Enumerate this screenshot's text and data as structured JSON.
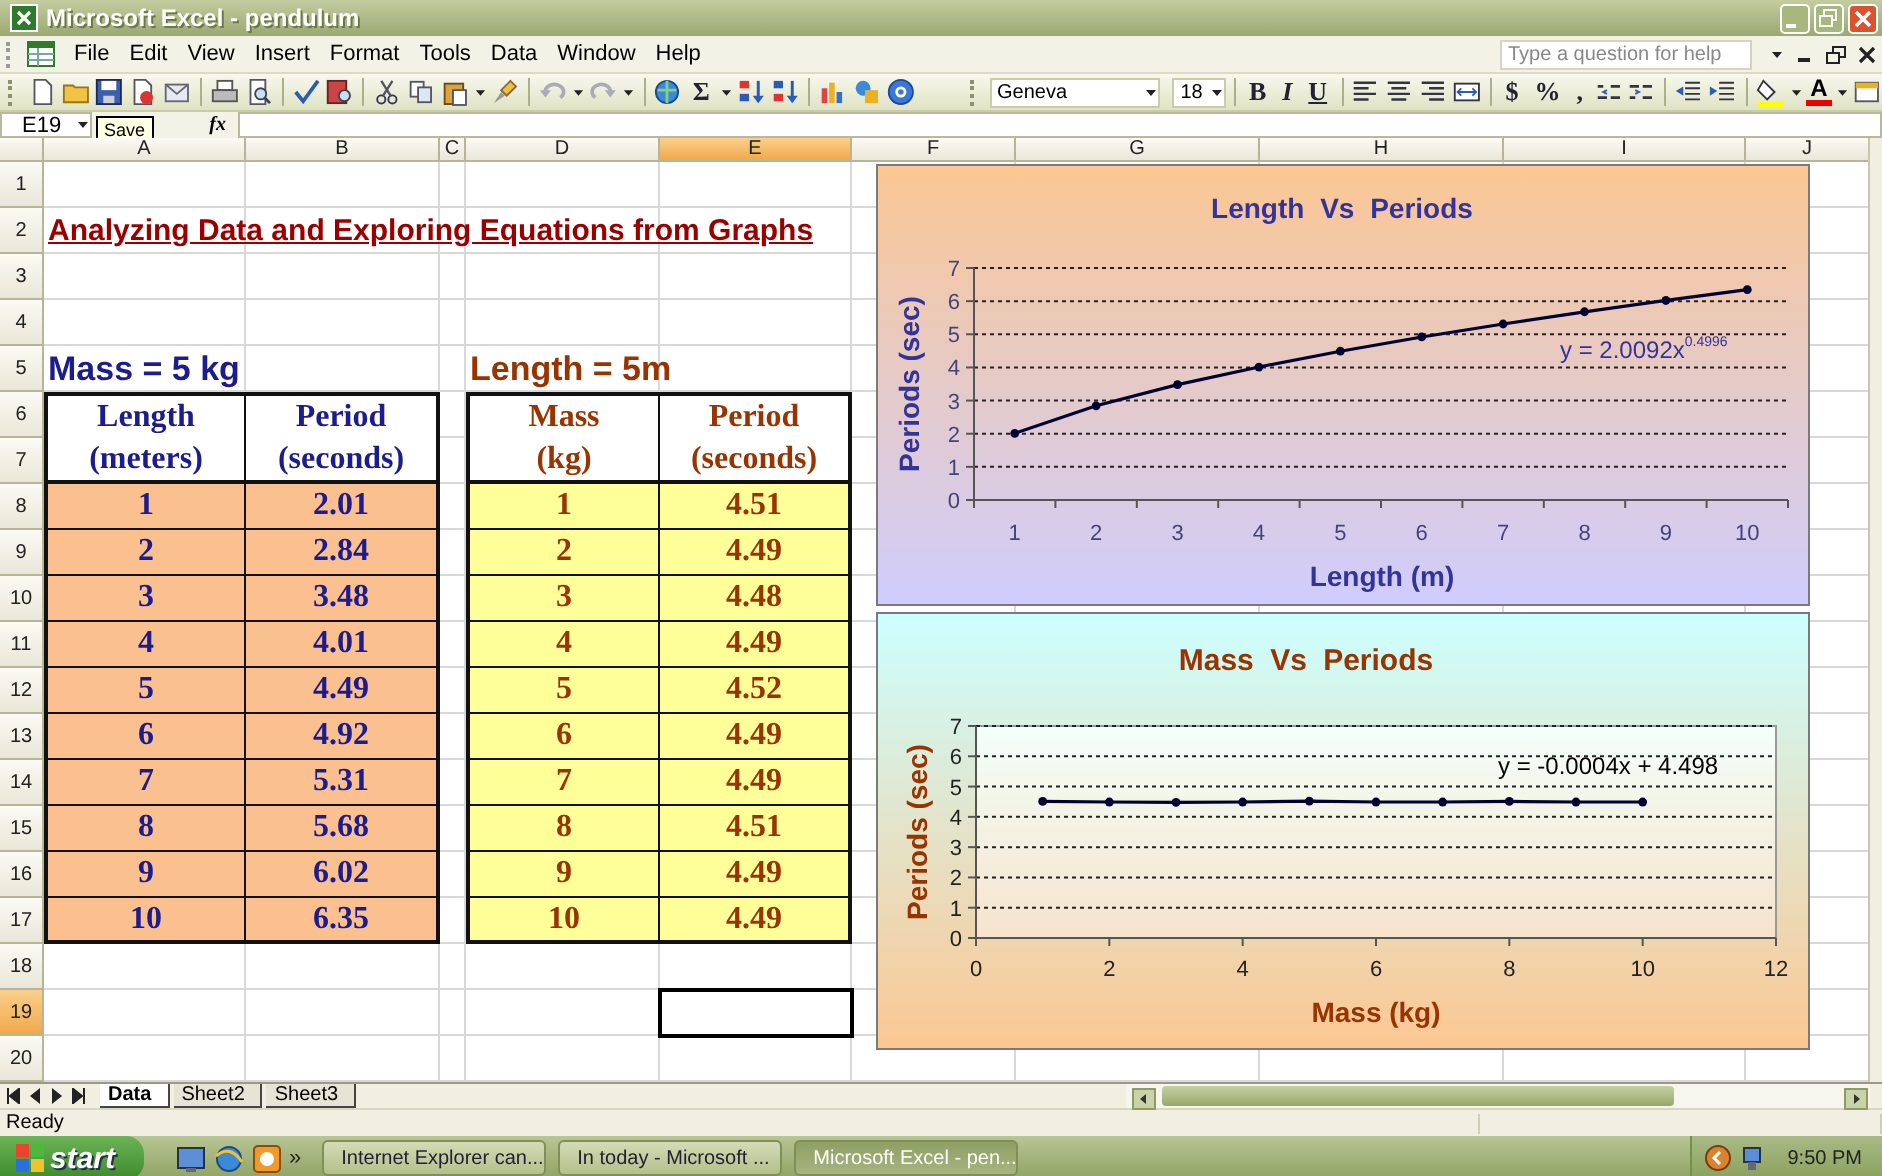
{
  "window": {
    "title": "Microsoft Excel - pendulum"
  },
  "menu": [
    "File",
    "Edit",
    "View",
    "Insert",
    "Format",
    "Tools",
    "Data",
    "Window",
    "Help"
  ],
  "help_search": {
    "placeholder": "Type a question for help"
  },
  "toolbar": {
    "autosum": "Σ",
    "font": "Geneva",
    "font_size": "18",
    "format_buttons": [
      "B",
      "I",
      "U"
    ],
    "number_buttons": [
      "$",
      "%",
      ","
    ],
    "font_color": "A"
  },
  "formula_bar": {
    "name_box": "E19",
    "tooltip": "Save",
    "function_label": "fx"
  },
  "sheet": {
    "columns": [
      {
        "label": "A",
        "selected": false
      },
      {
        "label": "B",
        "selected": false
      },
      {
        "label": "C",
        "selected": false
      },
      {
        "label": "D",
        "selected": false
      },
      {
        "label": "E",
        "selected": true
      },
      {
        "label": "F",
        "selected": false
      },
      {
        "label": "G",
        "selected": false
      },
      {
        "label": "H",
        "selected": false
      },
      {
        "label": "I",
        "selected": false
      },
      {
        "label": "J",
        "selected": false
      }
    ],
    "rows": [
      {
        "label": "1",
        "selected": false
      },
      {
        "label": "2",
        "selected": false
      },
      {
        "label": "3",
        "selected": false
      },
      {
        "label": "4",
        "selected": false
      },
      {
        "label": "5",
        "selected": false
      },
      {
        "label": "6",
        "selected": false
      },
      {
        "label": "7",
        "selected": false
      },
      {
        "label": "8",
        "selected": false
      },
      {
        "label": "9",
        "selected": false
      },
      {
        "label": "10",
        "selected": false
      },
      {
        "label": "11",
        "selected": false
      },
      {
        "label": "12",
        "selected": false
      },
      {
        "label": "13",
        "selected": false
      },
      {
        "label": "14",
        "selected": false
      },
      {
        "label": "15",
        "selected": false
      },
      {
        "label": "16",
        "selected": false
      },
      {
        "label": "17",
        "selected": false
      },
      {
        "label": "18",
        "selected": false
      },
      {
        "label": "19",
        "selected": true
      },
      {
        "label": "20",
        "selected": false
      }
    ],
    "title": "Analyzing Data and Exploring Equations from Graphs",
    "tables": [
      {
        "kind": "length",
        "caption": "Mass = 5 kg",
        "headers": [
          [
            "Length",
            "(meters)"
          ],
          [
            "Period",
            "(seconds)"
          ]
        ],
        "rows": [
          [
            "1",
            "2.01"
          ],
          [
            "2",
            "2.84"
          ],
          [
            "3",
            "3.48"
          ],
          [
            "4",
            "4.01"
          ],
          [
            "5",
            "4.49"
          ],
          [
            "6",
            "4.92"
          ],
          [
            "7",
            "5.31"
          ],
          [
            "8",
            "5.68"
          ],
          [
            "9",
            "6.02"
          ],
          [
            "10",
            "6.35"
          ]
        ]
      },
      {
        "kind": "mass",
        "caption": "Length = 5m",
        "headers": [
          [
            "Mass",
            "(kg)"
          ],
          [
            "Period",
            "(seconds)"
          ]
        ],
        "rows": [
          [
            "1",
            "4.51"
          ],
          [
            "2",
            "4.49"
          ],
          [
            "3",
            "4.48"
          ],
          [
            "4",
            "4.49"
          ],
          [
            "5",
            "4.52"
          ],
          [
            "6",
            "4.49"
          ],
          [
            "7",
            "4.49"
          ],
          [
            "8",
            "4.51"
          ],
          [
            "9",
            "4.49"
          ],
          [
            "10",
            "4.49"
          ]
        ]
      }
    ]
  },
  "charts": [
    {
      "kind": "peach",
      "chart_data": {
        "type": "line",
        "title": "Length Vs Periods",
        "xlabel": "Length (m)",
        "ylabel": "Periods (sec)",
        "categories": [
          "1",
          "2",
          "3",
          "4",
          "5",
          "6",
          "7",
          "8",
          "9",
          "10"
        ],
        "series": [
          {
            "color": "#000033",
            "marker": true,
            "values": [
              2.01,
              2.84,
              3.48,
              4.01,
              4.49,
              4.92,
              5.31,
              5.68,
              6.02,
              6.35
            ]
          }
        ],
        "grid": true,
        "ylim": [
          0,
          7
        ],
        "yticks": [
          0,
          1,
          2,
          3,
          4,
          5,
          6,
          7
        ],
        "annotations": [
          "y = 2.0092x$^{0.4996}$"
        ]
      }
    },
    {
      "kind": "aqua",
      "chart_data": {
        "type": "line",
        "grid": true,
        "title": "Mass Vs Periods",
        "xlabel": "Mass (kg)",
        "ylabel": "Periods (sec)",
        "x": [
          1,
          2,
          3,
          4,
          5,
          6,
          7,
          8,
          9,
          10
        ],
        "series": [
          {
            "color": "#000033",
            "marker": true,
            "values": [
              4.51,
              4.49,
              4.48,
              4.49,
              4.52,
              4.49,
              4.49,
              4.51,
              4.49,
              4.49
            ]
          }
        ],
        "xlim": [
          0,
          12
        ],
        "xticks": [
          0,
          2,
          4,
          6,
          8,
          10,
          12
        ],
        "ylim": [
          0,
          7
        ],
        "yticks": [
          0,
          1,
          2,
          3,
          4,
          5,
          6,
          7
        ],
        "annotations": [
          "y = -0.0004x + 4.498"
        ]
      }
    }
  ],
  "sheet_tabs": [
    {
      "label": "Data",
      "selected": true
    },
    {
      "label": "Sheet2",
      "selected": false
    },
    {
      "label": "Sheet3",
      "selected": false
    }
  ],
  "status_bar": {
    "text": "Ready"
  },
  "taskbar": {
    "start": "start",
    "overflow": "»",
    "tasks": [
      {
        "label": "Internet Explorer can...",
        "selected": false
      },
      {
        "label": "In today - Microsoft ...",
        "selected": false
      },
      {
        "label": "Microsoft Excel - pen...",
        "selected": true
      }
    ],
    "clock": "9:50 PM"
  }
}
